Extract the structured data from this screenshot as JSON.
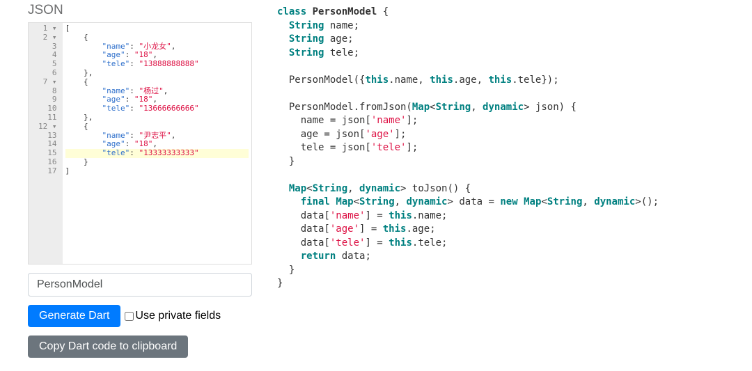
{
  "header": {
    "title": "JSON"
  },
  "editor": {
    "lines": [
      {
        "n": 1,
        "fold": true,
        "indent": "",
        "tokens": [
          {
            "t": "[",
            "c": "punct"
          }
        ]
      },
      {
        "n": 2,
        "fold": true,
        "indent": "    ",
        "tokens": [
          {
            "t": "{",
            "c": "punct"
          }
        ]
      },
      {
        "n": 3,
        "fold": false,
        "indent": "        ",
        "tokens": [
          {
            "t": "\"name\"",
            "c": "key"
          },
          {
            "t": ": ",
            "c": "punct"
          },
          {
            "t": "\"小龙女\"",
            "c": "str"
          },
          {
            "t": ",",
            "c": "punct"
          }
        ]
      },
      {
        "n": 4,
        "fold": false,
        "indent": "        ",
        "tokens": [
          {
            "t": "\"age\"",
            "c": "key"
          },
          {
            "t": ": ",
            "c": "punct"
          },
          {
            "t": "\"18\"",
            "c": "str"
          },
          {
            "t": ",",
            "c": "punct"
          }
        ]
      },
      {
        "n": 5,
        "fold": false,
        "indent": "        ",
        "tokens": [
          {
            "t": "\"tele\"",
            "c": "key"
          },
          {
            "t": ": ",
            "c": "punct"
          },
          {
            "t": "\"13888888888\"",
            "c": "str"
          }
        ]
      },
      {
        "n": 6,
        "fold": false,
        "indent": "    ",
        "tokens": [
          {
            "t": "},",
            "c": "punct"
          }
        ]
      },
      {
        "n": 7,
        "fold": true,
        "indent": "    ",
        "tokens": [
          {
            "t": "{",
            "c": "punct"
          }
        ]
      },
      {
        "n": 8,
        "fold": false,
        "indent": "        ",
        "tokens": [
          {
            "t": "\"name\"",
            "c": "key"
          },
          {
            "t": ": ",
            "c": "punct"
          },
          {
            "t": "\"杨过\"",
            "c": "str"
          },
          {
            "t": ",",
            "c": "punct"
          }
        ]
      },
      {
        "n": 9,
        "fold": false,
        "indent": "        ",
        "tokens": [
          {
            "t": "\"age\"",
            "c": "key"
          },
          {
            "t": ": ",
            "c": "punct"
          },
          {
            "t": "\"18\"",
            "c": "str"
          },
          {
            "t": ",",
            "c": "punct"
          }
        ]
      },
      {
        "n": 10,
        "fold": false,
        "indent": "        ",
        "tokens": [
          {
            "t": "\"tele\"",
            "c": "key"
          },
          {
            "t": ": ",
            "c": "punct"
          },
          {
            "t": "\"13666666666\"",
            "c": "str"
          }
        ]
      },
      {
        "n": 11,
        "fold": false,
        "indent": "    ",
        "tokens": [
          {
            "t": "},",
            "c": "punct"
          }
        ]
      },
      {
        "n": 12,
        "fold": true,
        "indent": "    ",
        "tokens": [
          {
            "t": "{",
            "c": "punct"
          }
        ]
      },
      {
        "n": 13,
        "fold": false,
        "indent": "        ",
        "tokens": [
          {
            "t": "\"name\"",
            "c": "key"
          },
          {
            "t": ": ",
            "c": "punct"
          },
          {
            "t": "\"尹志平\"",
            "c": "str"
          },
          {
            "t": ",",
            "c": "punct"
          }
        ]
      },
      {
        "n": 14,
        "fold": false,
        "indent": "        ",
        "tokens": [
          {
            "t": "\"age\"",
            "c": "key"
          },
          {
            "t": ": ",
            "c": "punct"
          },
          {
            "t": "\"18\"",
            "c": "str"
          },
          {
            "t": ",",
            "c": "punct"
          }
        ]
      },
      {
        "n": 15,
        "fold": false,
        "hl": true,
        "indent": "        ",
        "tokens": [
          {
            "t": "\"tele\"",
            "c": "key"
          },
          {
            "t": ": ",
            "c": "punct"
          },
          {
            "t": "\"13333333333\"",
            "c": "str"
          }
        ]
      },
      {
        "n": 16,
        "fold": false,
        "indent": "    ",
        "tokens": [
          {
            "t": "}",
            "c": "punct"
          }
        ]
      },
      {
        "n": 17,
        "fold": false,
        "indent": "",
        "tokens": [
          {
            "t": "]",
            "c": "punct"
          }
        ]
      }
    ]
  },
  "form": {
    "classname_value": "PersonModel",
    "generate_label": "Generate Dart",
    "checkbox_label": "Use private fields",
    "checkbox_checked": false,
    "copy_label": "Copy Dart code to clipboard"
  },
  "dart": {
    "lines": [
      [
        {
          "t": "class",
          "c": "kw"
        },
        {
          "t": " "
        },
        {
          "t": "PersonModel",
          "c": "cls"
        },
        {
          "t": " {"
        }
      ],
      [
        {
          "t": "  "
        },
        {
          "t": "String",
          "c": "typ"
        },
        {
          "t": " name;"
        }
      ],
      [
        {
          "t": "  "
        },
        {
          "t": "String",
          "c": "typ"
        },
        {
          "t": " age;"
        }
      ],
      [
        {
          "t": "  "
        },
        {
          "t": "String",
          "c": "typ"
        },
        {
          "t": " tele;"
        }
      ],
      [
        {
          "t": ""
        }
      ],
      [
        {
          "t": "  PersonModel({"
        },
        {
          "t": "this",
          "c": "kw"
        },
        {
          "t": ".name, "
        },
        {
          "t": "this",
          "c": "kw"
        },
        {
          "t": ".age, "
        },
        {
          "t": "this",
          "c": "kw"
        },
        {
          "t": ".tele});"
        }
      ],
      [
        {
          "t": ""
        }
      ],
      [
        {
          "t": "  PersonModel.fromJson("
        },
        {
          "t": "Map",
          "c": "typ"
        },
        {
          "t": "<"
        },
        {
          "t": "String",
          "c": "typ"
        },
        {
          "t": ", "
        },
        {
          "t": "dynamic",
          "c": "kw"
        },
        {
          "t": "> json) {"
        }
      ],
      [
        {
          "t": "    name = json["
        },
        {
          "t": "'name'",
          "c": "lit"
        },
        {
          "t": "];"
        }
      ],
      [
        {
          "t": "    age = json["
        },
        {
          "t": "'age'",
          "c": "lit"
        },
        {
          "t": "];"
        }
      ],
      [
        {
          "t": "    tele = json["
        },
        {
          "t": "'tele'",
          "c": "lit"
        },
        {
          "t": "];"
        }
      ],
      [
        {
          "t": "  }"
        }
      ],
      [
        {
          "t": ""
        }
      ],
      [
        {
          "t": "  "
        },
        {
          "t": "Map",
          "c": "typ"
        },
        {
          "t": "<"
        },
        {
          "t": "String",
          "c": "typ"
        },
        {
          "t": ", "
        },
        {
          "t": "dynamic",
          "c": "kw"
        },
        {
          "t": "> toJson() {"
        }
      ],
      [
        {
          "t": "    "
        },
        {
          "t": "final",
          "c": "kw"
        },
        {
          "t": " "
        },
        {
          "t": "Map",
          "c": "typ"
        },
        {
          "t": "<"
        },
        {
          "t": "String",
          "c": "typ"
        },
        {
          "t": ", "
        },
        {
          "t": "dynamic",
          "c": "kw"
        },
        {
          "t": "> data = "
        },
        {
          "t": "new",
          "c": "kw"
        },
        {
          "t": " "
        },
        {
          "t": "Map",
          "c": "typ"
        },
        {
          "t": "<"
        },
        {
          "t": "String",
          "c": "typ"
        },
        {
          "t": ", "
        },
        {
          "t": "dynamic",
          "c": "kw"
        },
        {
          "t": ">();"
        }
      ],
      [
        {
          "t": "    data["
        },
        {
          "t": "'name'",
          "c": "lit"
        },
        {
          "t": "] = "
        },
        {
          "t": "this",
          "c": "kw"
        },
        {
          "t": ".name;"
        }
      ],
      [
        {
          "t": "    data["
        },
        {
          "t": "'age'",
          "c": "lit"
        },
        {
          "t": "] = "
        },
        {
          "t": "this",
          "c": "kw"
        },
        {
          "t": ".age;"
        }
      ],
      [
        {
          "t": "    data["
        },
        {
          "t": "'tele'",
          "c": "lit"
        },
        {
          "t": "] = "
        },
        {
          "t": "this",
          "c": "kw"
        },
        {
          "t": ".tele;"
        }
      ],
      [
        {
          "t": "    "
        },
        {
          "t": "return",
          "c": "kw"
        },
        {
          "t": " data;"
        }
      ],
      [
        {
          "t": "  }"
        }
      ],
      [
        {
          "t": "}"
        }
      ]
    ]
  }
}
